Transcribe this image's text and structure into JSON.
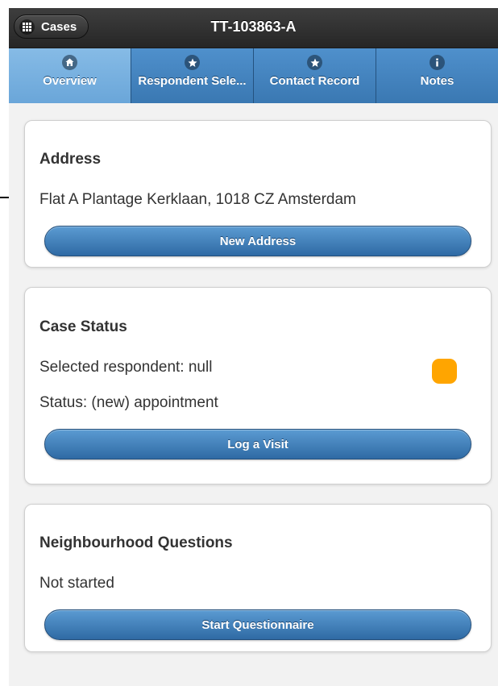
{
  "header": {
    "back_label": "Cases",
    "title": "TT-103863-A"
  },
  "tabs": [
    {
      "label": "Overview",
      "icon": "home-icon",
      "active": true
    },
    {
      "label": "Respondent Sele...",
      "icon": "star-icon",
      "active": false
    },
    {
      "label": "Contact Record",
      "icon": "star-icon",
      "active": false
    },
    {
      "label": "Notes",
      "icon": "info-icon",
      "active": false
    }
  ],
  "address": {
    "title": "Address",
    "value": "Flat A Plantage Kerklaan, 1018 CZ Amsterdam",
    "button": "New Address"
  },
  "case_status": {
    "title": "Case Status",
    "respondent": "Selected respondent: null",
    "status": "Status: (new) appointment",
    "status_color": "#ffa500",
    "button": "Log a Visit"
  },
  "neighbourhood": {
    "title": "Neighbourhood Questions",
    "state": "Not started",
    "button": "Start Questionnaire"
  },
  "colors": {
    "accent": "#3a78b2",
    "active_tab": "#6aa6d9",
    "header": "#2f2f2f"
  }
}
